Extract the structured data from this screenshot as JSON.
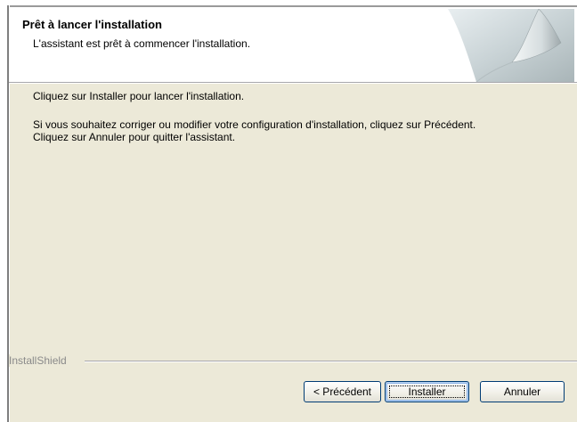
{
  "header": {
    "title": "Prêt à lancer l'installation",
    "subtitle": "L'assistant est prêt à commencer l'installation."
  },
  "body": {
    "line1": "Cliquez sur Installer pour lancer l'installation.",
    "line2": "Si vous souhaitez corriger ou modifier votre configuration d'installation, cliquez sur Précédent.",
    "line3": "Cliquez sur Annuler pour quitter l'assistant."
  },
  "footer": {
    "brand": "InstallShield",
    "buttons": {
      "back": "< Précédent",
      "install": "Installer",
      "cancel": "Annuler"
    }
  },
  "colors": {
    "face": "#ece9d8",
    "button_border": "#003c74",
    "brand_text": "#8a8a8a"
  }
}
